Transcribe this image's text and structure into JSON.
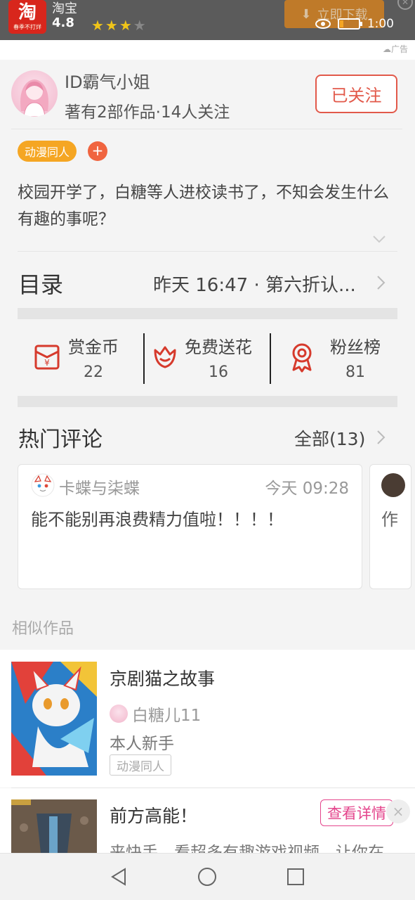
{
  "ad": {
    "app_name": "淘宝",
    "logo_char": "淘",
    "logo_slogan": "春季不打烊",
    "rating_count": "4.8",
    "download_label": "立即下载",
    "ad_label": "广告"
  },
  "status": {
    "time": "1:00",
    "battery_level": 0.2
  },
  "author": {
    "name": "ID霸气小姐",
    "meta": "著有2部作品·14人关注",
    "follow_label": "已关注"
  },
  "tags": {
    "primary": "动漫同人",
    "add": "+"
  },
  "description": "校园开学了，白糖等人进校读书了，不知会发生什么有趣的事呢？",
  "catalog": {
    "label": "目录",
    "update": "昨天 16:47 · 第六折认..."
  },
  "stats": [
    {
      "label": "赏金币",
      "value": "22",
      "icon": "red-envelope-icon"
    },
    {
      "label": "免费送花",
      "value": "16",
      "icon": "flower-icon"
    },
    {
      "label": "粉丝榜",
      "value": "81",
      "icon": "medal-icon"
    }
  ],
  "hot_comments": {
    "title": "热门评论",
    "all_label": "全部(13)",
    "items": [
      {
        "user": "卡蝶与柒蝶",
        "time": "今天 09:28",
        "text": "能不能别再浪费精力值啦！！！！"
      },
      {
        "user": "",
        "time": "",
        "text": "作"
      }
    ]
  },
  "similar": {
    "title": "相似作品",
    "works": [
      {
        "title": "京剧猫之故事",
        "author": "白糖儿11",
        "desc": "本人新手",
        "tag": "动漫同人"
      },
      {
        "title": "前方高能！",
        "desc": "来快手，看超多有趣游戏视频，让你在",
        "action": "查看详情",
        "close": "×"
      }
    ]
  },
  "colors": {
    "accent": "#e2594a",
    "tag_orange": "#f5a623",
    "pink": "#e4458c"
  }
}
